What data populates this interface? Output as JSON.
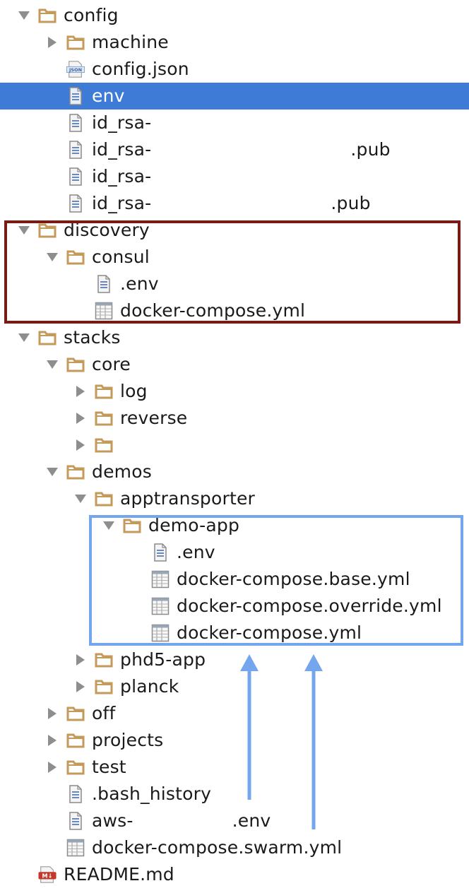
{
  "tree": [
    {
      "label": "config",
      "type": "folder",
      "depth": 0,
      "expanded": true,
      "icon": "folder-icon"
    },
    {
      "label": "machine",
      "type": "folder",
      "depth": 1,
      "expanded": false,
      "icon": "folder-icon"
    },
    {
      "label": "config.json",
      "type": "file",
      "depth": 1,
      "icon": "json-file-icon",
      "badge": "JSON"
    },
    {
      "label": "env",
      "type": "file",
      "depth": 1,
      "icon": "text-file-icon",
      "selected": true
    },
    {
      "label": "id_rsa-",
      "type": "file",
      "depth": 1,
      "icon": "text-file-icon"
    },
    {
      "label": "id_rsa-",
      "suffix": ".pub",
      "type": "file",
      "depth": 1,
      "icon": "text-file-icon",
      "gap": 282
    },
    {
      "label": "id_rsa-",
      "type": "file",
      "depth": 1,
      "icon": "text-file-icon"
    },
    {
      "label": "id_rsa-",
      "suffix": ".pub",
      "type": "file",
      "depth": 1,
      "icon": "text-file-icon",
      "gap": 254
    },
    {
      "label": "discovery",
      "type": "folder",
      "depth": 0,
      "expanded": true,
      "icon": "folder-icon"
    },
    {
      "label": "consul",
      "type": "folder",
      "depth": 1,
      "expanded": true,
      "icon": "folder-icon"
    },
    {
      "label": ".env",
      "type": "file",
      "depth": 2,
      "icon": "text-file-icon"
    },
    {
      "label": "docker-compose.yml",
      "type": "file",
      "depth": 2,
      "icon": "yml-file-icon"
    },
    {
      "label": "stacks",
      "type": "folder",
      "depth": 0,
      "expanded": true,
      "icon": "folder-icon"
    },
    {
      "label": "core",
      "type": "folder",
      "depth": 1,
      "expanded": true,
      "icon": "folder-icon"
    },
    {
      "label": "log",
      "type": "folder",
      "depth": 2,
      "expanded": false,
      "icon": "folder-icon"
    },
    {
      "label": "reverse",
      "type": "folder",
      "depth": 2,
      "expanded": false,
      "icon": "folder-icon"
    },
    {
      "label": "",
      "type": "folder",
      "depth": 2,
      "expanded": false,
      "icon": "folder-icon"
    },
    {
      "label": "demos",
      "type": "folder",
      "depth": 1,
      "expanded": true,
      "icon": "folder-icon"
    },
    {
      "label": "apptransporter",
      "type": "folder",
      "depth": 2,
      "expanded": true,
      "icon": "folder-icon"
    },
    {
      "label": "demo-app",
      "type": "folder",
      "depth": 3,
      "expanded": true,
      "icon": "folder-icon"
    },
    {
      "label": ".env",
      "type": "file",
      "depth": 4,
      "icon": "text-file-icon"
    },
    {
      "label": "docker-compose.base.yml",
      "type": "file",
      "depth": 4,
      "icon": "yml-file-icon"
    },
    {
      "label": "docker-compose.override.yml",
      "type": "file",
      "depth": 4,
      "icon": "yml-file-icon"
    },
    {
      "label": "docker-compose.yml",
      "type": "file",
      "depth": 4,
      "icon": "yml-file-icon"
    },
    {
      "label": "phd5-app",
      "type": "folder",
      "depth": 2,
      "expanded": false,
      "icon": "folder-icon"
    },
    {
      "label": "planck",
      "type": "folder",
      "depth": 2,
      "expanded": false,
      "icon": "folder-icon"
    },
    {
      "label": "off",
      "type": "folder",
      "depth": 1,
      "expanded": false,
      "icon": "folder-icon"
    },
    {
      "label": "projects",
      "type": "folder",
      "depth": 1,
      "expanded": false,
      "icon": "folder-icon"
    },
    {
      "label": "test",
      "type": "folder",
      "depth": 1,
      "expanded": false,
      "icon": "folder-icon"
    },
    {
      "label": ".bash_history",
      "type": "file",
      "depth": 1,
      "icon": "text-file-icon"
    },
    {
      "label": "aws-",
      "suffix": ".env",
      "type": "file",
      "depth": 1,
      "icon": "text-file-icon",
      "gap": 140
    },
    {
      "label": "docker-compose.swarm.yml",
      "type": "file",
      "depth": 1,
      "icon": "yml-file-icon"
    },
    {
      "label": "README.md",
      "type": "file",
      "depth": 0,
      "icon": "markdown-file-icon",
      "badge": "M↓"
    }
  ],
  "colors": {
    "selection": "#3d7bd6",
    "folder": "#c49a5a",
    "red_box": "#7a1a14",
    "blue_box": "#74a6ee",
    "arrow": "#74a6ee"
  }
}
